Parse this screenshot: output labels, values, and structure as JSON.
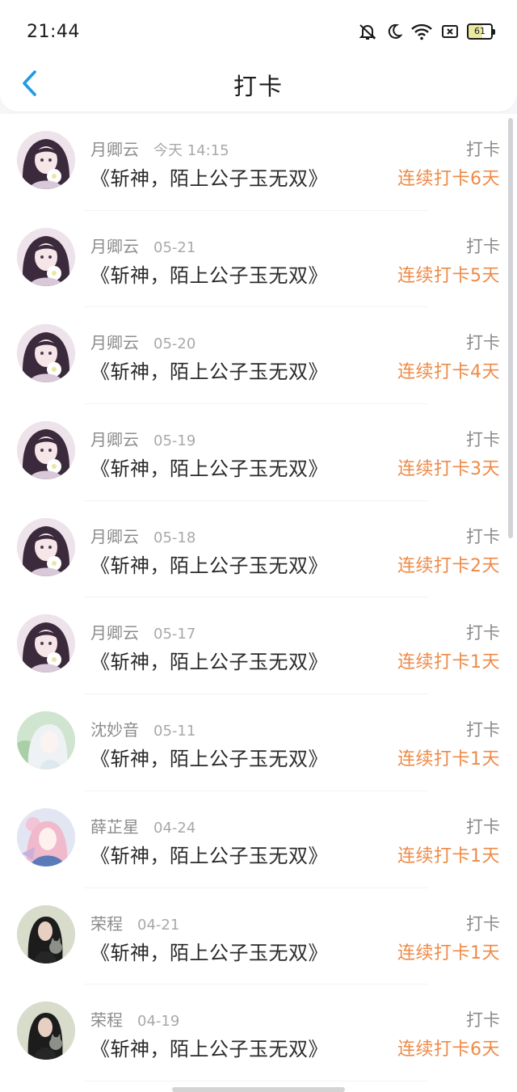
{
  "status_bar": {
    "time": "21:44",
    "battery": "61",
    "icons": [
      "mute-icon",
      "moon-icon",
      "wifi-icon",
      "sim-icon",
      "battery-icon"
    ]
  },
  "header": {
    "title": "打卡",
    "back_icon": "chevron-left-icon"
  },
  "colors": {
    "accent": "#1e9be4",
    "streak": "#ee8a47",
    "meta": "#8c8c8c",
    "title": "#1d1d1d"
  },
  "checkins": [
    {
      "user": "月卿云",
      "date": "今天 14:15",
      "book": "《斩神，陌上公子玉无双》",
      "action": "打卡",
      "streak": "连续打卡6天",
      "avatar": "dark-hair-girl"
    },
    {
      "user": "月卿云",
      "date": "05-21",
      "book": "《斩神，陌上公子玉无双》",
      "action": "打卡",
      "streak": "连续打卡5天",
      "avatar": "dark-hair-girl"
    },
    {
      "user": "月卿云",
      "date": "05-20",
      "book": "《斩神，陌上公子玉无双》",
      "action": "打卡",
      "streak": "连续打卡4天",
      "avatar": "dark-hair-girl"
    },
    {
      "user": "月卿云",
      "date": "05-19",
      "book": "《斩神，陌上公子玉无双》",
      "action": "打卡",
      "streak": "连续打卡3天",
      "avatar": "dark-hair-girl"
    },
    {
      "user": "月卿云",
      "date": "05-18",
      "book": "《斩神，陌上公子玉无双》",
      "action": "打卡",
      "streak": "连续打卡2天",
      "avatar": "dark-hair-girl"
    },
    {
      "user": "月卿云",
      "date": "05-17",
      "book": "《斩神，陌上公子玉无双》",
      "action": "打卡",
      "streak": "连续打卡1天",
      "avatar": "dark-hair-girl"
    },
    {
      "user": "沈妙音",
      "date": "05-11",
      "book": "《斩神，陌上公子玉无双》",
      "action": "打卡",
      "streak": "连续打卡1天",
      "avatar": "white-hair-girl"
    },
    {
      "user": "薛芷星",
      "date": "04-24",
      "book": "《斩神，陌上公子玉无双》",
      "action": "打卡",
      "streak": "连续打卡1天",
      "avatar": "pink-hair-girl"
    },
    {
      "user": "荣程",
      "date": "04-21",
      "book": "《斩神，陌上公子玉无双》",
      "action": "打卡",
      "streak": "连续打卡1天",
      "avatar": "photo-girl-with-cat"
    },
    {
      "user": "荣程",
      "date": "04-19",
      "book": "《斩神，陌上公子玉无双》",
      "action": "打卡",
      "streak": "连续打卡6天",
      "avatar": "photo-girl-with-cat"
    }
  ]
}
